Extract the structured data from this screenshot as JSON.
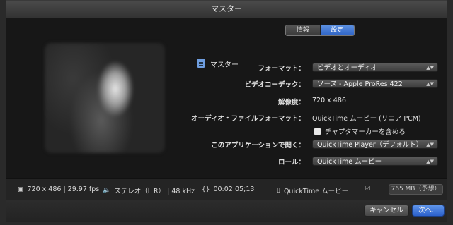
{
  "window": {
    "title": "マスター"
  },
  "tabs": [
    {
      "label": "情報"
    },
    {
      "label": "設定"
    }
  ],
  "master_name": "マスター",
  "settings": {
    "format_label": "フォーマット：",
    "format_value": "ビデオとオーディオ",
    "codec_label": "ビデオコーデック：",
    "codec_value": "ソース - Apple ProRes 422",
    "resolution_label": "解像度：",
    "resolution_value": "720 x 486",
    "audio_format_label": "オーディオ・ファイルフォーマット：",
    "audio_format_value": "QuickTime ムービー (リニア PCM)",
    "chapter_markers_label": "チャプタマーカーを含める",
    "open_with_label": "このアプリケーションで開く：",
    "open_with_value": "QuickTime Player（デフォルト）",
    "role_label": "ロール：",
    "role_value": "QuickTime ムービー"
  },
  "status_bar": {
    "video": "720 x 486 | 29.97 fps",
    "audio": "ステレオ（L R） | 48 kHz",
    "duration": "00:02:05;13",
    "file_type": "QuickTime ムービー",
    "size": "765 MB（予想）"
  },
  "buttons": {
    "cancel": "キャンセル",
    "next": "次へ..."
  },
  "colors": {
    "accent": "#2f64c6",
    "background": "#171717"
  }
}
